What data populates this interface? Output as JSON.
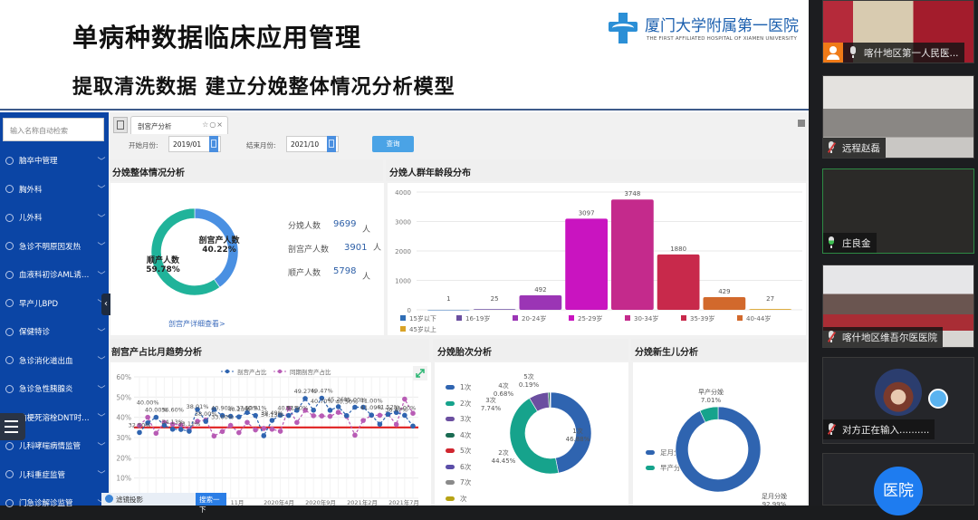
{
  "slide": {
    "title": "单病种数据临床应用管理",
    "subtitle": "提取清洗数据  建立分娩整体情况分析模型",
    "logo_cn": "厦门大学附属第一医院",
    "logo_en": "THE FIRST AFFILIATED HOSPITAL OF XIAMEN UNIVERSITY"
  },
  "sidebar": {
    "search_placeholder": "输入名称自动检索",
    "items": [
      {
        "label": "脑卒中管理"
      },
      {
        "label": "胸外科"
      },
      {
        "label": "儿外科"
      },
      {
        "label": "急诊不明原因发热"
      },
      {
        "label": "血液科初诊AML诱导..."
      },
      {
        "label": "早产儿BPD"
      },
      {
        "label": "保健特诊"
      },
      {
        "label": "急诊消化道出血"
      },
      {
        "label": "急诊急性胰腺炎"
      },
      {
        "label": "脑梗死溶栓DNT时间..."
      },
      {
        "label": "儿科哮喘病情监管"
      },
      {
        "label": "儿科重症监管"
      },
      {
        "label": "门急诊解诊监管"
      }
    ],
    "collapse_icon": "‹"
  },
  "tabs": {
    "active_label": "剖宫产分析",
    "actions": "☆○×"
  },
  "filters": {
    "start_label": "开始月份:",
    "start_value": "2019/01",
    "end_label": "结束月份:",
    "end_value": "2021/10",
    "query_label": "查询"
  },
  "overview": {
    "title": "分娩整体情况分析",
    "stats": [
      {
        "label": "分娩人数",
        "value": "9699",
        "unit": "人"
      },
      {
        "label": "剖宫产人数",
        "value": "3901",
        "unit": "人"
      },
      {
        "label": "顺产人数",
        "value": "5798",
        "unit": "人"
      }
    ],
    "detail_link": "剖宫产详细查看>",
    "colors": {
      "cesarean": "#4a90e2",
      "natural": "#20b39a"
    }
  },
  "bottom_bar": {
    "app_label": "滤镜投影",
    "button_label": "搜索一下"
  },
  "chart_data": [
    {
      "type": "pie",
      "title": "分娩整体情况分析",
      "donut": true,
      "slices": [
        {
          "name": "剖宫产人数",
          "value": 40.22,
          "label": "40.22%",
          "color": "#4a90e2"
        },
        {
          "name": "顺产人数",
          "value": 59.78,
          "label": "59.78%",
          "color": "#20b39a"
        }
      ]
    },
    {
      "type": "bar",
      "title": "分娩人群年龄段分布",
      "categories": [
        "15岁以下",
        "16-19岁",
        "20-24岁",
        "25-29岁",
        "30-34岁",
        "35-39岁",
        "40-44岁",
        "45岁以上"
      ],
      "values": [
        1,
        25,
        492,
        3097,
        3748,
        1880,
        429,
        27
      ],
      "colors": [
        "#2f6db5",
        "#6b4fa0",
        "#9b35b5",
        "#c914c0",
        "#c42a8c",
        "#c8294b",
        "#d2692c",
        "#d9a327"
      ],
      "ylim": [
        0,
        4000
      ],
      "yticks": [
        0,
        1000,
        2000,
        3000,
        4000
      ],
      "legend": "bottom",
      "grid": true
    },
    {
      "type": "line",
      "title": "剖宫产占比月趋势分析",
      "yticks": [
        "0%",
        "10%",
        "20%",
        "30%",
        "40%",
        "50%",
        "60%"
      ],
      "ylim": [
        0,
        60
      ],
      "x_tick_labels": [
        "11月",
        "2020年4月",
        "2020年9月",
        "2021年2月",
        "2021年7月"
      ],
      "reference_line": 35,
      "reference_color": "#e02020",
      "series": [
        {
          "name": "剖宫产占比",
          "color": "#2f64b0",
          "values": [
            32.5,
            37.27,
            40.0,
            36.06,
            34.13,
            34.0,
            33.12,
            43.91,
            38.0,
            43.92,
            40.9,
            40.5,
            40.23,
            42.4,
            40.91,
            30.9,
            38.49,
            41.09,
            40.91,
            43.5,
            49.27,
            43.52,
            49.47,
            43.5,
            45.26,
            40.86,
            45.0,
            45.0,
            41.09,
            36.6,
            41.52,
            42.44,
            41.0,
            35.7
          ]
        },
        {
          "name": "同期剖宫产占比",
          "color": "#b85cb5",
          "values": [
            36.0,
            40.0,
            32.13,
            37.5,
            36.6,
            36.2,
            34.0,
            38.01,
            38.67,
            30.77,
            33.0,
            36.01,
            32.43,
            37.5,
            33.79,
            34.5,
            34.13,
            33.12,
            44.5,
            37.5,
            43.5,
            40.8,
            40.7,
            40.5,
            42.5,
            40.5,
            31.19,
            38.45,
            41.0,
            41.0,
            41.5,
            36.47,
            49.0,
            42.0
          ]
        }
      ]
    },
    {
      "type": "pie",
      "title": "分娩胎次分析",
      "donut": true,
      "legend": "left",
      "slices": [
        {
          "name": "1次",
          "value": 46.88,
          "label": "46.88%",
          "color": "#2f64b0"
        },
        {
          "name": "2次",
          "value": 44.45,
          "label": "44.45%",
          "color": "#16a38c"
        },
        {
          "name": "3次",
          "value": 7.74,
          "label": "7.74%",
          "color": "#6b4fa0"
        },
        {
          "name": "4次",
          "value": 0.68,
          "label": "0.68%",
          "color": "#1a6b52"
        },
        {
          "name": "5次",
          "value": 0.19,
          "label": "0.19%",
          "color": "#d0262f"
        },
        {
          "name": "6次",
          "value": 0.03,
          "label": "",
          "color": "#5b4ea8"
        },
        {
          "name": "7次",
          "value": 0.02,
          "label": "",
          "color": "#8a8a8a"
        },
        {
          "name": "次",
          "value": 0.01,
          "label": "",
          "color": "#b7a315"
        }
      ]
    },
    {
      "type": "pie",
      "title": "分娩新生儿分析",
      "donut": true,
      "legend": "left",
      "slices": [
        {
          "name": "足月分娩",
          "value": 92.99,
          "label": "92.99%",
          "color": "#2f64b0"
        },
        {
          "name": "早产分娩",
          "value": 7.01,
          "label": "7.01%",
          "color": "#16a38c"
        }
      ]
    }
  ],
  "video": {
    "participants": [
      {
        "name": "喀什地区第一人民医...",
        "mic": "on",
        "host": true
      },
      {
        "name": "远程赵磊",
        "mic": "muted"
      },
      {
        "name": "庄良金",
        "mic": "speaking"
      },
      {
        "name": "喀什地区维吾尔医医院",
        "mic": "muted"
      },
      {
        "name": "对方正在输入..........",
        "mic": "muted"
      },
      {
        "name": "医院",
        "avatar_text": "医院"
      }
    ]
  }
}
